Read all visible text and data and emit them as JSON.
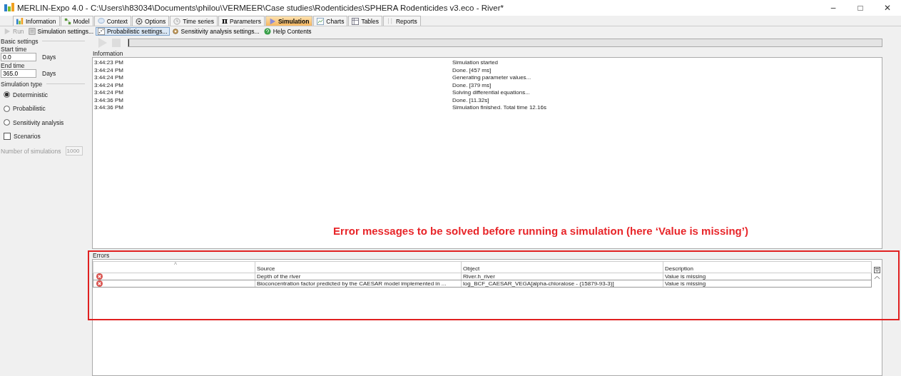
{
  "window": {
    "title": "MERLIN-Expo 4.0 - C:\\Users\\h83034\\Documents\\philou\\VERMEER\\Case studies\\Rodenticides\\SPHERA Rodenticides v3.eco - River*",
    "controls": [
      "–",
      "□",
      "✕"
    ]
  },
  "tabs": [
    {
      "label": "Information",
      "selected": false
    },
    {
      "label": "Model",
      "selected": false
    },
    {
      "label": "Context",
      "selected": false
    },
    {
      "label": "Options",
      "selected": false
    },
    {
      "label": "Time series",
      "selected": false
    },
    {
      "label": "Parameters",
      "glyph": "π",
      "selected": false
    },
    {
      "label": "Simulation",
      "selected": true
    },
    {
      "label": "Charts",
      "selected": false
    },
    {
      "label": "Tables",
      "selected": false
    },
    {
      "label": "Reports",
      "selected": false
    }
  ],
  "toolbar": [
    {
      "label": "Run",
      "disabled": true,
      "selected": false
    },
    {
      "label": "Simulation settings...",
      "disabled": false,
      "selected": false
    },
    {
      "label": "Probabilistic settings...",
      "disabled": false,
      "selected": true
    },
    {
      "label": "Sensitivity analysis settings...",
      "disabled": false,
      "selected": false
    },
    {
      "label": "Help Contents",
      "disabled": false,
      "selected": false
    }
  ],
  "sidebar": {
    "basic_settings": "Basic settings",
    "fields": [
      {
        "label": "Start time",
        "value": "0.0",
        "unit": "Days"
      },
      {
        "label": "End time",
        "value": "365.0",
        "unit": "Days"
      }
    ],
    "simulation_type": "Simulation type",
    "options": [
      {
        "kind": "radio",
        "label": "Deterministic",
        "checked": true
      },
      {
        "kind": "radio",
        "label": "Probabilistic",
        "checked": false
      },
      {
        "kind": "radio",
        "label": "Sensitivity analysis",
        "checked": false
      },
      {
        "kind": "checkbox",
        "label": "Scenarios",
        "checked": false
      }
    ],
    "number_of_simulations": {
      "label": "Number of simulations",
      "value": "1000",
      "disabled": true
    }
  },
  "run_bar": {
    "level": 0
  },
  "information": {
    "title": "Information",
    "rows": [
      {
        "time": "3:44:23 PM",
        "message": "Simulation started"
      },
      {
        "time": "3:44:24 PM",
        "message": "Done. [457 ms]"
      },
      {
        "time": "3:44:24 PM",
        "message": "Generating parameter values..."
      },
      {
        "time": "3:44:24 PM",
        "message": "Done. [379 ms]"
      },
      {
        "time": "3:44:24 PM",
        "message": "Solving differential equations..."
      },
      {
        "time": "3:44:36 PM",
        "message": "Done. [11.32s]"
      },
      {
        "time": "3:44:36 PM",
        "message": "Simulation finished. Total time 12.16s"
      }
    ]
  },
  "annotation": "Error messages to be solved before running a simulation (here ‘Value is missing’)",
  "errors": {
    "title": "Errors",
    "sort_mark": "^",
    "columns": [
      "Source",
      "Object",
      "Description"
    ],
    "rows": [
      {
        "source": "Depth of the river",
        "object": "River.h_river",
        "description": "Value is missing"
      },
      {
        "source": "Bioconcentration factor predicted by the CAESAR model implemented in ...",
        "object": "log_BCF_CAESAR_VEGA[alpha-chloralose - (15879-93-3)]",
        "description": "Value is missing"
      }
    ]
  }
}
